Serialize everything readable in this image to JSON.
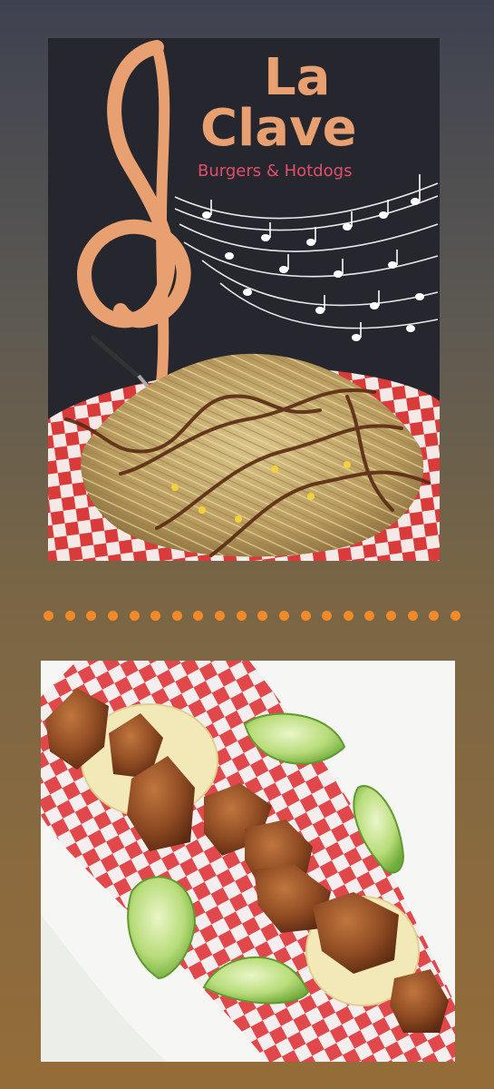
{
  "top_photo": {
    "sign": {
      "brand_line1": "La",
      "brand_line2": "Clave",
      "tagline": "Burgers & Hotdogs"
    },
    "dish": "pile of shoestring potato sticks with corn and barbecue sauce drizzle on red-and-white checkered paper"
  },
  "bottom_photo": {
    "dish": "fried pork belly (chicharrón) on tortillas with lime wedges on checkered paper"
  },
  "divider": {
    "dot_count": 20
  },
  "colors": {
    "accent_orange": "#f28a2a",
    "sign_orange": "#e8a070",
    "sign_pink": "#e0506a",
    "checker_red": "#d93a3a"
  }
}
